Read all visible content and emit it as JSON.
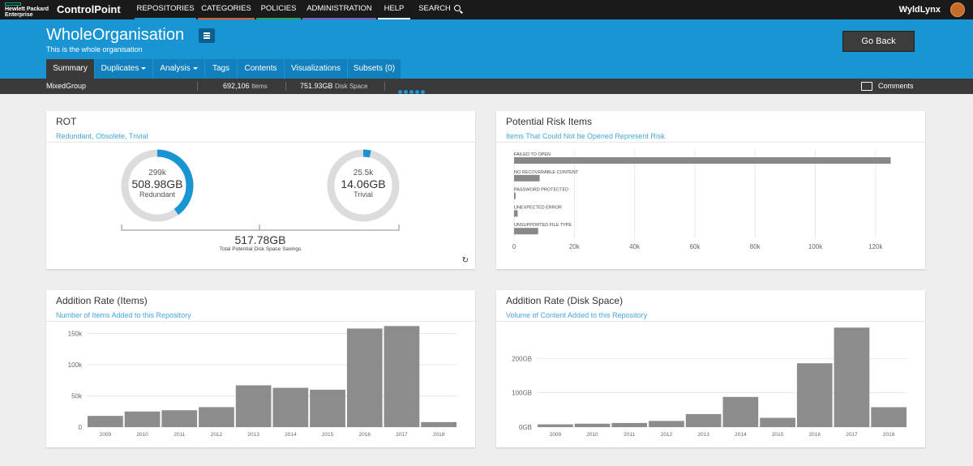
{
  "topbar": {
    "logo_line1": "Hewlett Packard",
    "logo_line2": "Enterprise",
    "product": "ControlPoint",
    "nav": [
      {
        "label": "REPOSITORIES",
        "color": "#1a95d3"
      },
      {
        "label": "CATEGORIES",
        "color": "#e85c2c"
      },
      {
        "label": "POLICIES",
        "color": "#2da05a"
      },
      {
        "label": "ADMINISTRATION",
        "color": "#8c5ab8"
      },
      {
        "label": "HELP",
        "color": "#ffffff"
      }
    ],
    "search_label": "SEARCH",
    "user": "WyldLynx"
  },
  "header": {
    "title": "WholeOrganisation",
    "subtitle": "This is the whole organisation",
    "go_back": "Go Back",
    "tabs": [
      "Summary",
      "Duplicates",
      "Analysis",
      "Tags",
      "Contents",
      "Visualizations",
      "Subsets (0)"
    ]
  },
  "infobar": {
    "group": "MixedGroup",
    "items_value": "692,106",
    "items_label": "Items",
    "disk_value": "751.93GB",
    "disk_label": "Disk Space",
    "comments": "Comments"
  },
  "rot": {
    "title": "ROT",
    "subtitle": "Redundant, Obsolete, Trivial",
    "redundant": {
      "count": "299k",
      "size": "508.98GB",
      "label": "Redundant",
      "fraction": 0.4
    },
    "trivial": {
      "count": "25.5k",
      "size": "14.06GB",
      "label": "Trivial",
      "fraction": 0.035
    },
    "total": "517.78GB",
    "total_label": "Total Potential Disk Space Savings",
    "accent": "#1a95d3"
  },
  "risk": {
    "title": "Potential Risk Items",
    "subtitle": "Items That Could Not be Opened Represent Risk",
    "chart_data": {
      "type": "bar",
      "orientation": "horizontal",
      "categories": [
        "FAILED TO OPEN",
        "NO RECOVERABLE CONTENT",
        "PASSWORD PROTECTED",
        "UNEXPECTED ERROR",
        "UNSUPPORTED FILE TYPE"
      ],
      "values": [
        125000,
        8500,
        500,
        1200,
        8000
      ],
      "xlim": [
        0,
        130000
      ],
      "xticks": [
        0,
        20000,
        40000,
        60000,
        80000,
        100000,
        120000
      ],
      "xtick_labels": [
        "0",
        "20k",
        "40k",
        "60k",
        "80k",
        "100k",
        "120k"
      ],
      "grid": true,
      "color": "#888888"
    }
  },
  "items_rate": {
    "title": "Addition Rate (Items)",
    "subtitle": "Number of Items Added to this Repository",
    "chart_data": {
      "type": "bar",
      "categories": [
        "2009",
        "2010",
        "2011",
        "2012",
        "2013",
        "2014",
        "2015",
        "2016",
        "2017",
        "2018"
      ],
      "values": [
        18000,
        25000,
        27000,
        32000,
        67000,
        63000,
        60000,
        158000,
        162000,
        8000
      ],
      "ylim": [
        0,
        165000
      ],
      "yticks": [
        0,
        50000,
        100000,
        150000
      ],
      "ytick_labels": [
        "0",
        "50k",
        "100k",
        "150k"
      ],
      "grid": true,
      "color": "#8c8c8c"
    }
  },
  "disk_rate": {
    "title": "Addition Rate (Disk Space)",
    "subtitle": "Volume of Content Added to this Repository",
    "chart_data": {
      "type": "bar",
      "categories": [
        "2009",
        "2010",
        "2011",
        "2012",
        "2013",
        "2014",
        "2015",
        "2016",
        "2017",
        "2018"
      ],
      "values": [
        8,
        10,
        12,
        18,
        38,
        88,
        27,
        186,
        290,
        58
      ],
      "ylim": [
        0,
        300
      ],
      "yticks": [
        0,
        100,
        200
      ],
      "ytick_labels": [
        "0GB",
        "100GB",
        "200GB"
      ],
      "grid": true,
      "color": "#8c8c8c"
    }
  }
}
